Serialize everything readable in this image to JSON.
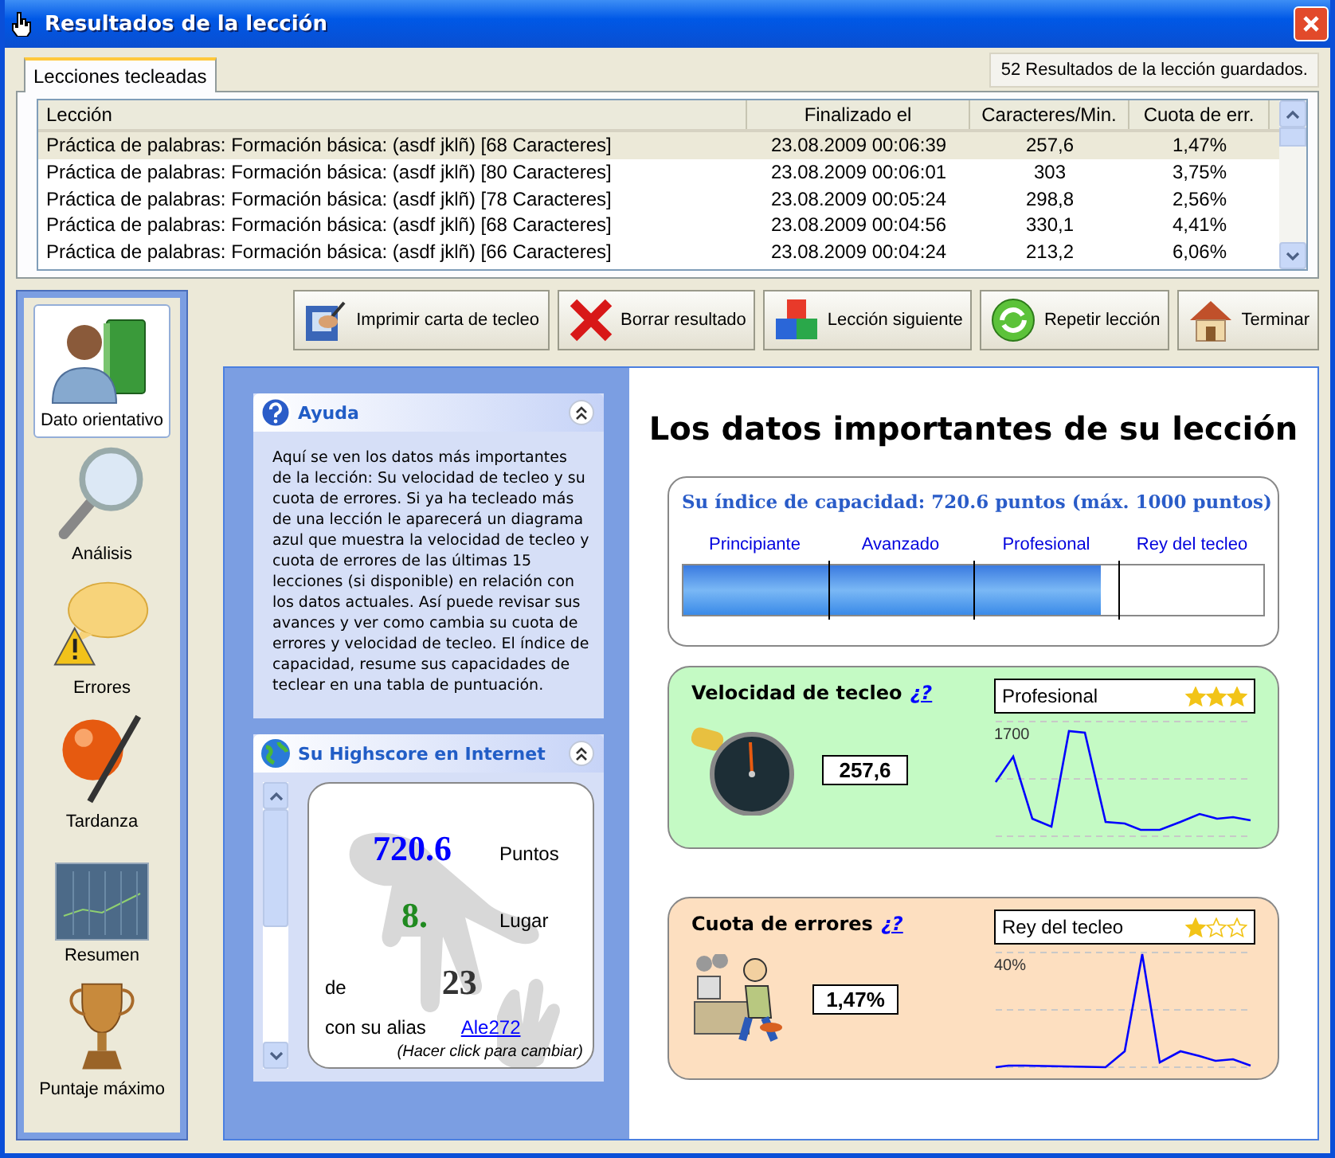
{
  "window": {
    "title": "Resultados de la lección"
  },
  "tabs": [
    {
      "label": "Lecciones tecleadas",
      "selected": true
    }
  ],
  "saved_count": "52 Resultados de la lección guardados.",
  "table": {
    "columns": [
      "Lección",
      "Finalizado el",
      "Caracteres/Min.",
      "Cuota de err."
    ],
    "rows": [
      {
        "cells": [
          "Práctica de palabras: Formación básica: (asdf jklñ) [68 Caracteres]",
          "23.08.2009 00:06:39",
          "257,6",
          "1,47%"
        ],
        "selected": true
      },
      {
        "cells": [
          "Práctica de palabras: Formación básica: (asdf jklñ) [80 Caracteres]",
          "23.08.2009 00:06:01",
          "303",
          "3,75%"
        ],
        "selected": false
      },
      {
        "cells": [
          "Práctica de palabras: Formación básica: (asdf jklñ) [78 Caracteres]",
          "23.08.2009 00:05:24",
          "298,8",
          "2,56%"
        ],
        "selected": false
      },
      {
        "cells": [
          "Práctica de palabras: Formación básica: (asdf jklñ) [68 Caracteres]",
          "23.08.2009 00:04:56",
          "330,1",
          "4,41%"
        ],
        "selected": false
      },
      {
        "cells": [
          "Práctica de palabras: Formación básica: (asdf jklñ) [66 Caracteres]",
          "23.08.2009 00:04:24",
          "213,2",
          "6,06%"
        ],
        "selected": false
      }
    ]
  },
  "sidebar": {
    "items": [
      {
        "label": "Dato orientativo",
        "selected": true
      },
      {
        "label": "Análisis",
        "selected": false
      },
      {
        "label": "Errores",
        "selected": false
      },
      {
        "label": "Tardanza",
        "selected": false
      },
      {
        "label": "Resumen",
        "selected": false
      },
      {
        "label": "Puntaje máximo",
        "selected": false
      }
    ]
  },
  "toolbar": {
    "buttons": [
      "Imprimir carta de tecleo",
      "Borrar resultado",
      "Lección siguiente",
      "Repetir lección",
      "Terminar"
    ]
  },
  "help_panel": {
    "title": "Ayuda",
    "text": "Aquí se ven los datos más importantes de la lección: Su velocidad de tecleo y su cuota de errores. Si ya ha tecleado más de una lección le aparecerá un diagrama azul que muestra la velocidad de tecleo y cuota de errores de las últimas 15 lecciones (si disponible) en relación con los datos actuales. Así puede revisar sus avances y ver como cambia su cuota de errores y velocidad de tecleo. El índice de capacidad, resume sus capacidades de teclear en una tabla de puntuación."
  },
  "highscore_panel": {
    "title": "Su Highscore en Internet",
    "points": "720.6",
    "points_label": "Puntos",
    "rank": "8.",
    "rank_label": "Lugar",
    "of_label": "de",
    "total": "23",
    "alias_label": "con su alias",
    "alias": "Ale272",
    "alias_hint": "(Hacer click para cambiar)"
  },
  "summary": {
    "heading": "Los datos importantes de su lección",
    "capacity": {
      "title": "Su índice de capacidad: 720.6 puntos (máx. 1000 puntos)",
      "levels": [
        "Principiante",
        "Avanzado",
        "Profesional",
        "Rey del tecleo"
      ],
      "level": 0.72
    },
    "metrics": [
      {
        "kind": "speed",
        "title": "Velocidad de tecleo",
        "help_link": "¿?",
        "value": "257,6",
        "rating": "Profesional",
        "stars": 3,
        "axis_label": "1700"
      },
      {
        "kind": "errors",
        "title": "Cuota de errores",
        "help_link": "¿?",
        "value": "1,47%",
        "rating": "Rey del tecleo",
        "stars": 1,
        "axis_label": "40%"
      }
    ]
  }
}
